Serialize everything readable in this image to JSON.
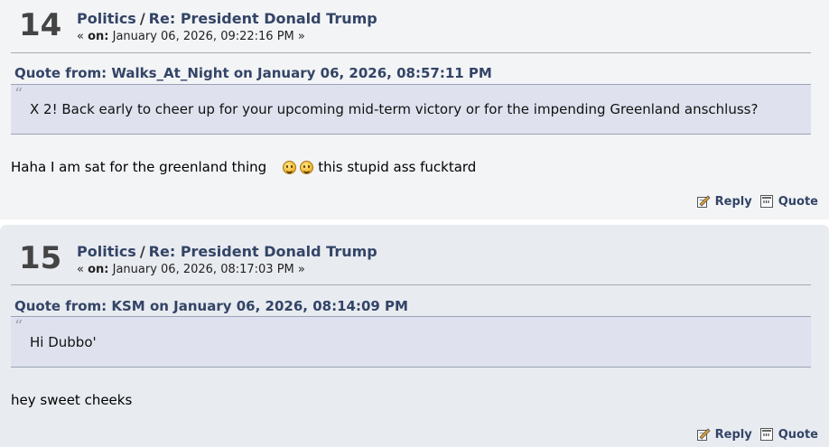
{
  "posts": [
    {
      "number": "14",
      "board": "Politics",
      "separator": "/",
      "subject": "Re: President Donald Trump",
      "meta_prefix": "« ",
      "meta_on": "on:",
      "meta_date": " January 06, 2026, 09:22:16 PM »",
      "quote_header": "Quote from: Walks_At_Night on January 06, 2026, 08:57:11 PM",
      "quote_mark": "“",
      "quote_text": "X 2!  Back early to cheer up for your upcoming mid-term victory or for the impending Greenland anschluss?",
      "body_before": "Haha I am sat for the greenland thing",
      "body_after": "this stupid ass fucktard",
      "smileys": [
        "smiley-icon",
        "smiley-icon"
      ],
      "reply_label": "Reply",
      "quote_label": "Quote"
    },
    {
      "number": "15",
      "board": "Politics",
      "separator": "/",
      "subject": "Re: President Donald Trump",
      "meta_prefix": "« ",
      "meta_on": "on:",
      "meta_date": " January 06, 2026, 08:17:03 PM »",
      "quote_header": "Quote from: KSM on January 06, 2026, 08:14:09 PM",
      "quote_mark": "“",
      "quote_text": "Hi Dubbo'",
      "body_text": "hey sweet cheeks",
      "reply_label": "Reply",
      "quote_label": "Quote"
    }
  ],
  "colors": {
    "link": "#334466",
    "post_bg_1": "#f3f4f6",
    "post_bg_2": "#e8ebf0",
    "quote_bg": "#dfe2ee"
  },
  "icons": {
    "reply": "reply-icon",
    "quote": "quote-icon"
  }
}
